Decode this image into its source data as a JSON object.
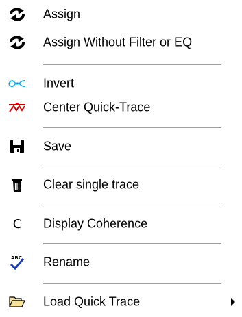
{
  "menu": {
    "items": [
      {
        "label": "Assign",
        "icon": "swap-arrows-icon"
      },
      {
        "label": "Assign Without Filter or EQ",
        "icon": "swap-arrows-icon"
      },
      {
        "label": "Invert",
        "icon": "invert-wave-icon"
      },
      {
        "label": "Center Quick-Trace",
        "icon": "center-trace-icon"
      },
      {
        "label": "Save",
        "icon": "floppy-disk-icon"
      },
      {
        "label": "Clear single trace",
        "icon": "trash-can-icon"
      },
      {
        "label": "Display Coherence",
        "icon": "letter-c-icon",
        "icon_text": "C"
      },
      {
        "label": "Rename",
        "icon": "spellcheck-icon",
        "icon_text": "ABC"
      },
      {
        "label": "Load Quick Trace",
        "icon": "open-folder-icon",
        "has_submenu": true
      }
    ]
  }
}
